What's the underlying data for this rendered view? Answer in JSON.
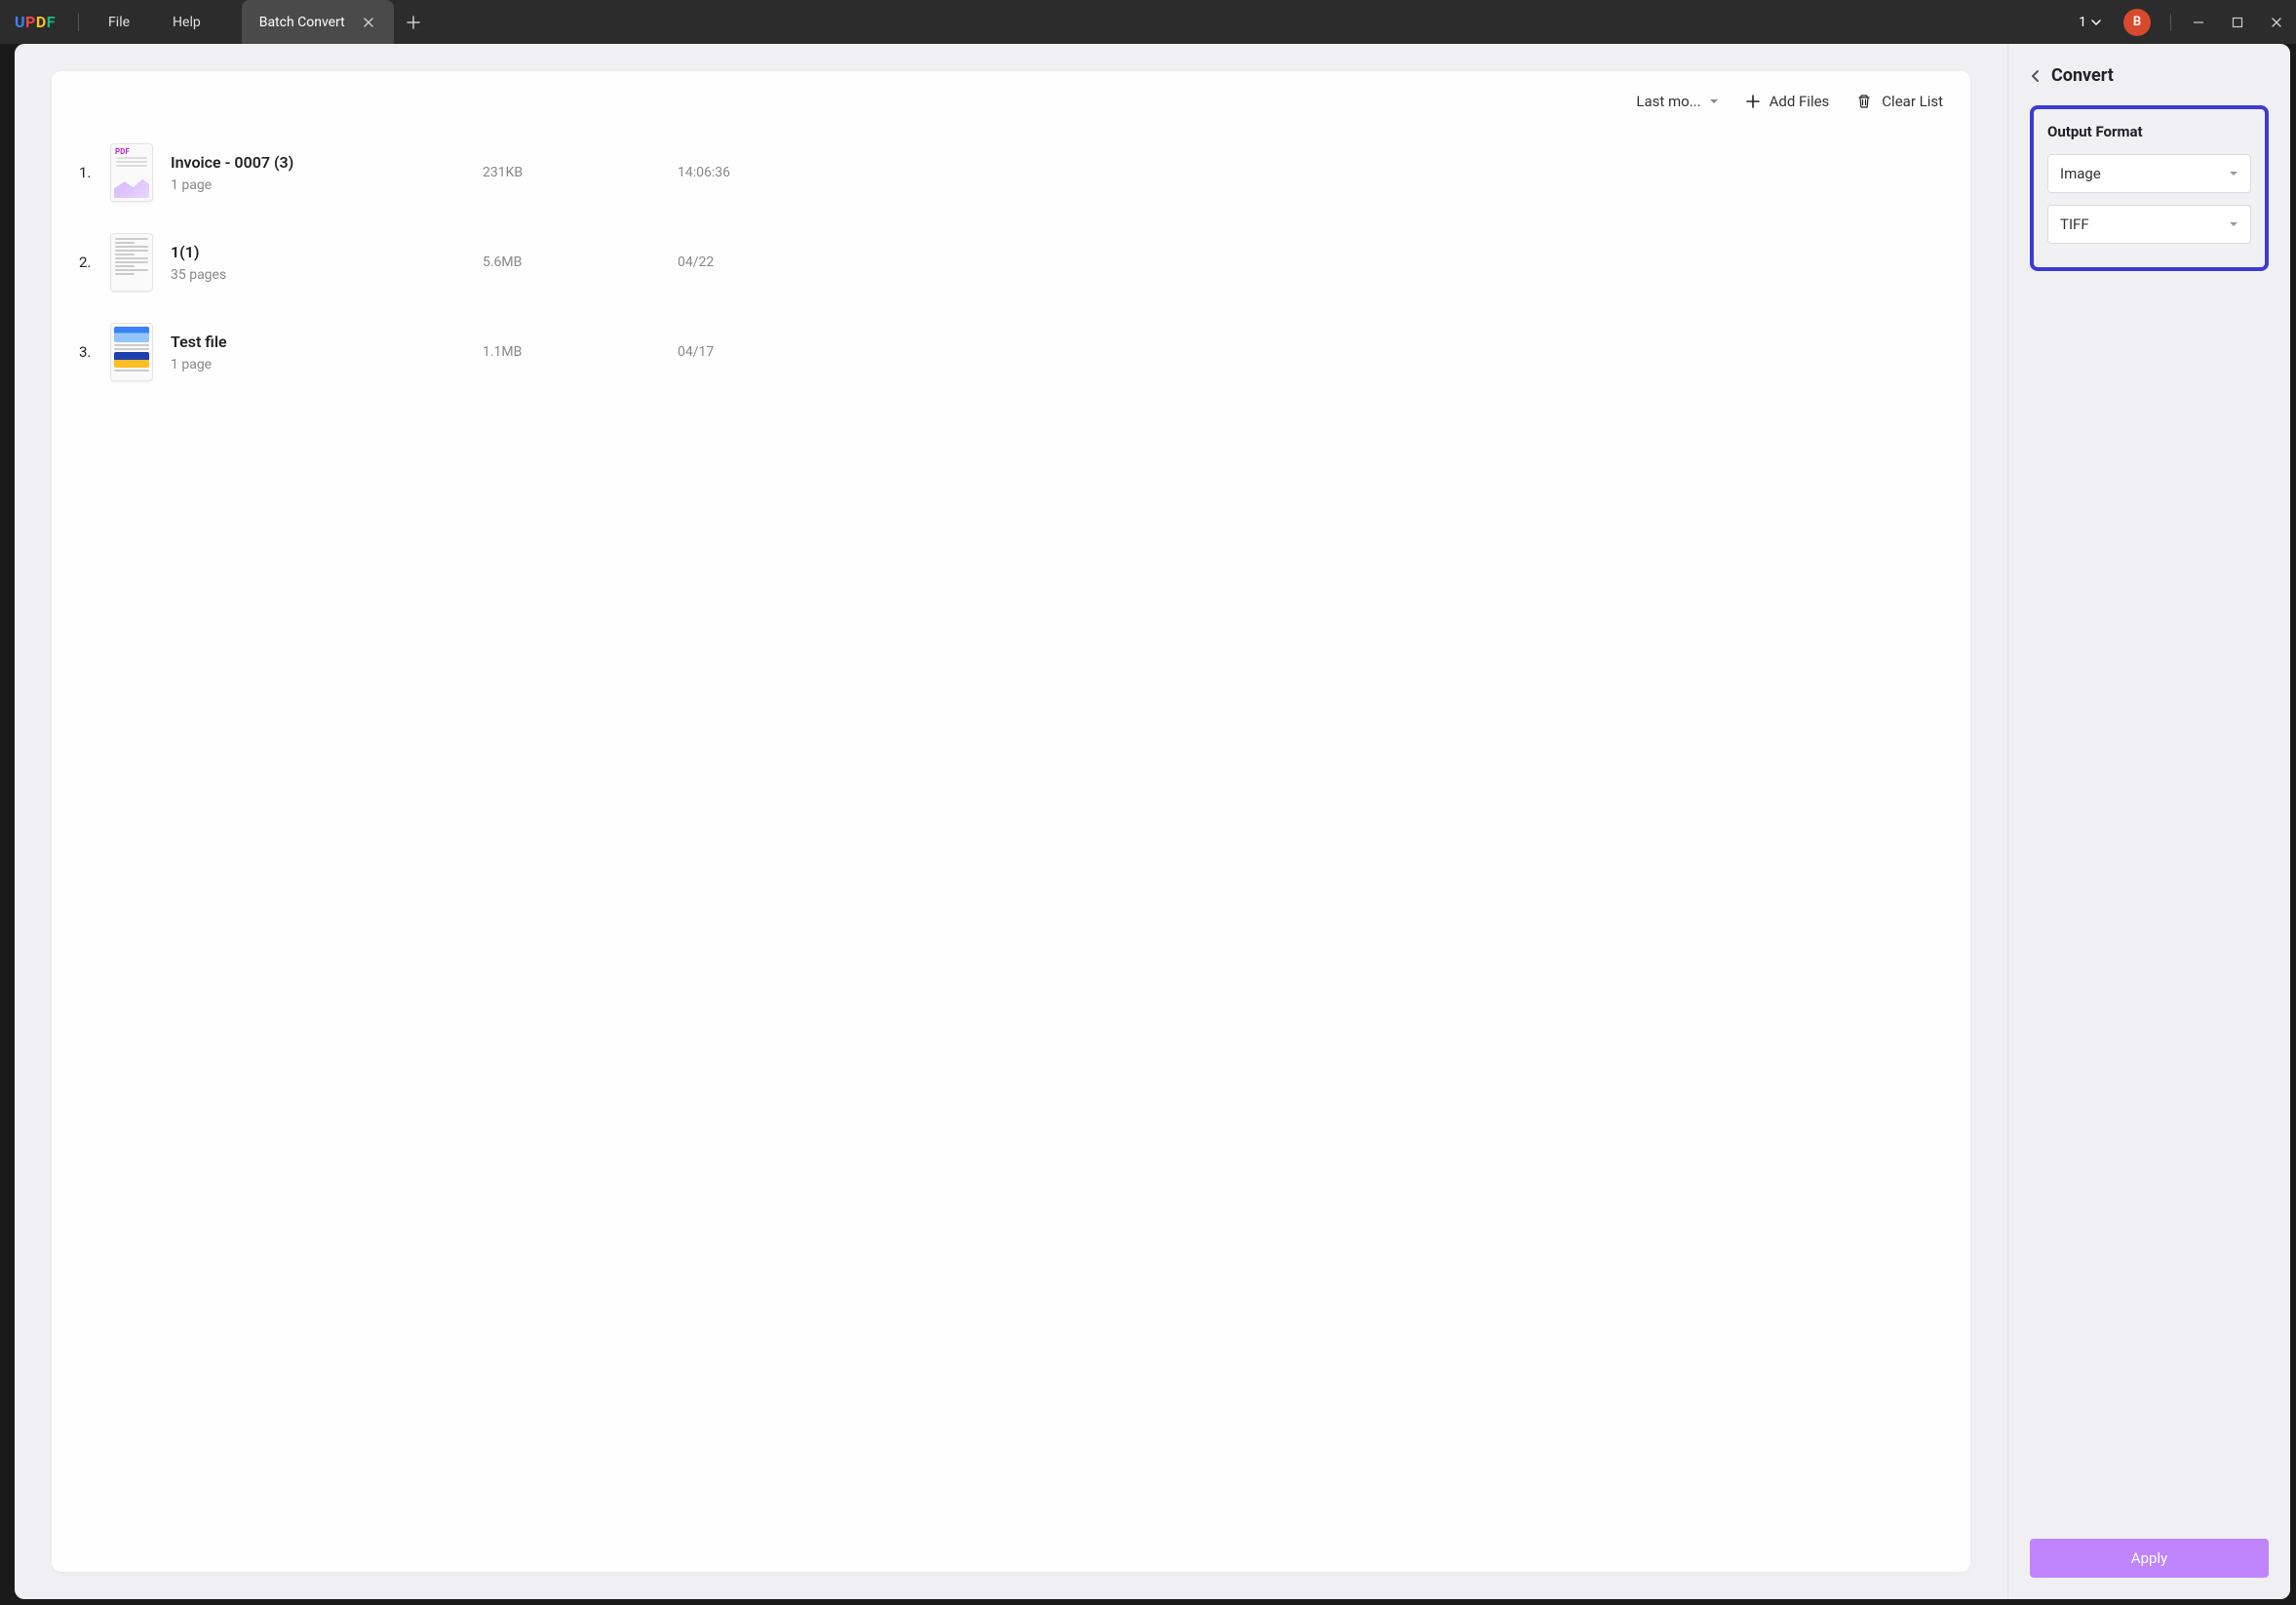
{
  "titlebar": {
    "logo_letters": [
      "U",
      "P",
      "D",
      "F"
    ],
    "menu": {
      "file": "File",
      "help": "Help"
    },
    "tab_label": "Batch Convert",
    "doc_count": "1",
    "avatar_letter": "B"
  },
  "toolbar": {
    "sort_label": "Last mo...",
    "add_files": "Add Files",
    "clear_list": "Clear List"
  },
  "files": [
    {
      "thumb": "pdf",
      "title": "Invoice - 0007 (3)",
      "pages": "1 page",
      "size": "231KB",
      "date": "14:06:36"
    },
    {
      "thumb": "doc",
      "title": "1(1)",
      "pages": "35 pages",
      "size": "5.6MB",
      "date": "04/22"
    },
    {
      "thumb": "rich",
      "title": "Test file",
      "pages": "1 page",
      "size": "1.1MB",
      "date": "04/17"
    }
  ],
  "side": {
    "title": "Convert",
    "output_label": "Output Format",
    "format_type": "Image",
    "image_subtype": "TIFF",
    "apply": "Apply"
  }
}
